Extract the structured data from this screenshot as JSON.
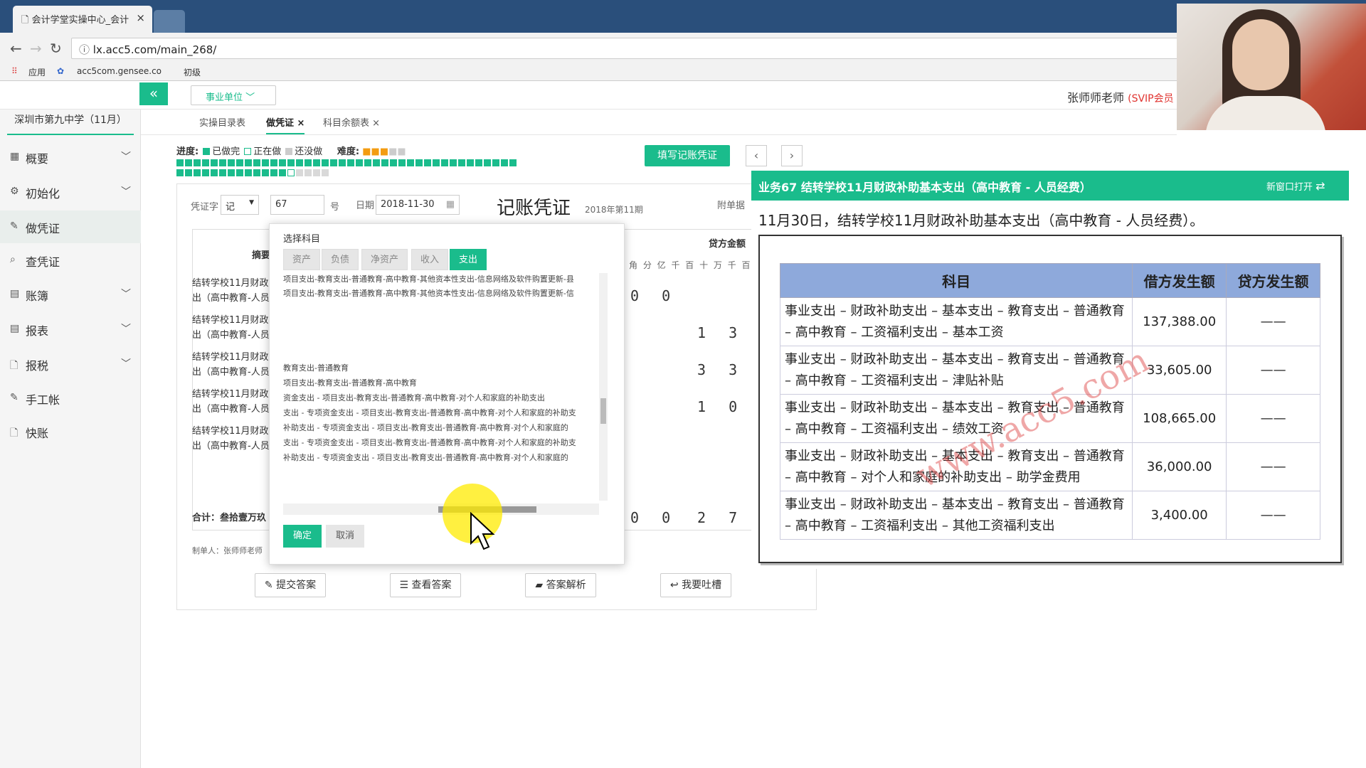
{
  "browser": {
    "tab_title": "会计学堂实操中心_会计",
    "url": "lx.acc5.com/main_268/",
    "bookmarks": [
      "应用",
      "acc5com.gensee.co",
      "初级"
    ]
  },
  "header": {
    "unit_select": "事业单位",
    "teacher": "张师师老师",
    "svip": "(SVIP会员"
  },
  "sidebar": {
    "school": "深圳市第九中学（11月）",
    "items": [
      {
        "label": "概要",
        "icon": "grid-icon",
        "chev": "﹀"
      },
      {
        "label": "初始化",
        "icon": "gear-icon",
        "chev": "﹀"
      },
      {
        "label": "做凭证",
        "icon": "pen-icon",
        "chev": ""
      },
      {
        "label": "查凭证",
        "icon": "search-icon",
        "chev": ""
      },
      {
        "label": "账簿",
        "icon": "book-icon",
        "chev": "﹀"
      },
      {
        "label": "报表",
        "icon": "report-icon",
        "chev": "﹀"
      },
      {
        "label": "报税",
        "icon": "file-icon",
        "chev": "﹀"
      },
      {
        "label": "手工帐",
        "icon": "pen-icon",
        "chev": ""
      },
      {
        "label": "快账",
        "icon": "file-icon",
        "chev": ""
      }
    ]
  },
  "tabs": [
    {
      "label": "实操目录表"
    },
    {
      "label": "做凭证"
    },
    {
      "label": "科目余额表"
    }
  ],
  "progress": {
    "label": "进度:",
    "done": "已做完",
    "doing": "正在做",
    "todo": "还没做",
    "difficulty_label": "难度:",
    "fill_button": "填写记账凭证"
  },
  "voucher": {
    "voucher_word_label": "凭证字",
    "voucher_word": "记",
    "number": "67",
    "number_suffix": "号",
    "date_label": "日期",
    "date": "2018-11-30",
    "title": "记账凭证",
    "period": "2018年第11期",
    "attachment_label": "附单据",
    "summary_header": "摘要",
    "credit_header": "贷方金额",
    "digit_headers": "角 分 亿 千 百 十 万 千 百",
    "rows": [
      {
        "line1": "结转学校11月财政",
        "line2": "出（高中教育-人员",
        "amount": "0 0"
      },
      {
        "line1": "结转学校11月财政",
        "line2": "出（高中教育-人员",
        "amount": "1 3 7 3"
      },
      {
        "line1": "结转学校11月财政",
        "line2": "出（高中教育-人员",
        "amount": "3 3 6"
      },
      {
        "line1": "结转学校11月财政",
        "line2": "出（高中教育-人员",
        "amount": "1 0 8 6"
      },
      {
        "line1": "结转学校11月财政",
        "line2": "出（高中教育-人员",
        "amount": ""
      }
    ],
    "total_label": "合计：叁拾壹万玖",
    "total_debit_digits": "0 0",
    "total_credit_digits": "2 7 9 6",
    "maker": "制单人：张师师老师",
    "buttons": [
      "提交答案",
      "查看答案",
      "答案解析",
      "我要吐槽"
    ]
  },
  "picker": {
    "title": "选择科目",
    "tabs": [
      "资产",
      "负债",
      "净资产",
      "收入",
      "支出"
    ],
    "lines": [
      "项目支出-教育支出-普通教育-高中教育-其他资本性支出-信息网络及软件购置更新-县",
      "项目支出-教育支出-普通教育-高中教育-其他资本性支出-信息网络及软件购置更新-信",
      "",
      "",
      "",
      "",
      "教育支出-普通教育",
      "项目支出-教育支出-普通教育-高中教育",
      "资金支出 - 项目支出-教育支出-普通教育-高中教育-对个人和家庭的补助支出",
      "支出 - 专项资金支出 - 项目支出-教育支出-普通教育-高中教育-对个人和家庭的补助支",
      "补助支出 - 专项资金支出 - 项目支出-教育支出-普通教育-高中教育-对个人和家庭的",
      "支出 - 专项资金支出 - 项目支出-教育支出-普通教育-高中教育-对个人和家庭的补助支",
      "补助支出 - 专项资金支出 - 项目支出-教育支出-普通教育-高中教育-对个人和家庭的"
    ],
    "ok": "确定",
    "cancel": "取消"
  },
  "business": {
    "title": "业务67 结转学校11月财政补助基本支出（高中教育 - 人员经费）",
    "open_new": "新窗口打开",
    "description": "11月30日，结转学校11月财政补助基本支出（高中教育 - 人员经费）。",
    "table": {
      "headers": [
        "科目",
        "借方发生额",
        "贷方发生额"
      ],
      "rows": [
        {
          "subject_l1": "事业支出 – 财政补助支出 – 基本支出 – 教育支出 – 普通教育",
          "subject_l2": "– 高中教育 – 工资福利支出 – 基本工资",
          "debit": "137,388.00",
          "credit": "——"
        },
        {
          "subject_l1": "事业支出 – 财政补助支出 – 基本支出 – 教育支出 – 普通教育",
          "subject_l2": "– 高中教育 – 工资福利支出 – 津贴补贴",
          "debit": "33,605.00",
          "credit": "——"
        },
        {
          "subject_l1": "事业支出 – 财政补助支出 – 基本支出 – 教育支出 – 普通教育",
          "subject_l2": "– 高中教育 – 工资福利支出 – 绩效工资",
          "debit": "108,665.00",
          "credit": "——"
        },
        {
          "subject_l1": "事业支出 – 财政补助支出 – 基本支出 – 教育支出 – 普通教育",
          "subject_l2": "– 高中教育 – 对个人和家庭的补助支出 – 助学金费用",
          "debit": "36,000.00",
          "credit": "——"
        },
        {
          "subject_l1": "事业支出 – 财政补助支出 – 基本支出 – 教育支出 – 普通教育",
          "subject_l2": "– 高中教育 – 工资福利支出 – 其他工资福利支出",
          "debit": "3,400.00",
          "credit": "——"
        }
      ]
    },
    "watermark": "www.acc5.com"
  }
}
